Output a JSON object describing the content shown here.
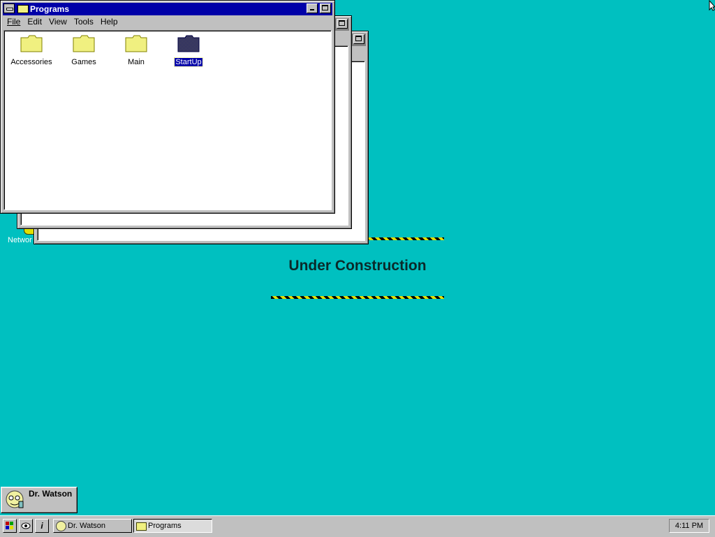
{
  "desktop": {
    "background": "#00c0c0",
    "banner_text": "Under Construction",
    "partial_icon_label": "Networ"
  },
  "windows": {
    "back1": {
      "title": ""
    },
    "back2": {
      "title": ""
    },
    "programs": {
      "title": "Programs",
      "menu": [
        "File",
        "Edit",
        "View",
        "Tools",
        "Help"
      ],
      "items": [
        {
          "label": "Accessories",
          "icon": "folder-icon",
          "selected": false
        },
        {
          "label": "Games",
          "icon": "folder-icon",
          "selected": false
        },
        {
          "label": "Main",
          "icon": "folder-icon",
          "selected": false
        },
        {
          "label": "StartUp",
          "icon": "folder-icon",
          "selected": true
        }
      ]
    }
  },
  "dr_watson": {
    "label": "Dr. Watson",
    "icon": "dr-watson-icon"
  },
  "taskbar": {
    "tray_icons": [
      "start-icon",
      "eye-icon",
      "info-icon"
    ],
    "buttons": [
      {
        "label": "Dr. Watson",
        "icon": "dr-watson-icon",
        "pressed": false
      },
      {
        "label": "Programs",
        "icon": "folder-icon",
        "pressed": true
      }
    ],
    "clock": "4:11 PM"
  },
  "colors": {
    "title_active": "#0000a8",
    "title_inactive": "#808080",
    "face": "#c0c0c0",
    "folder": "#f0f080",
    "hazard_yellow": "#e0e000"
  }
}
